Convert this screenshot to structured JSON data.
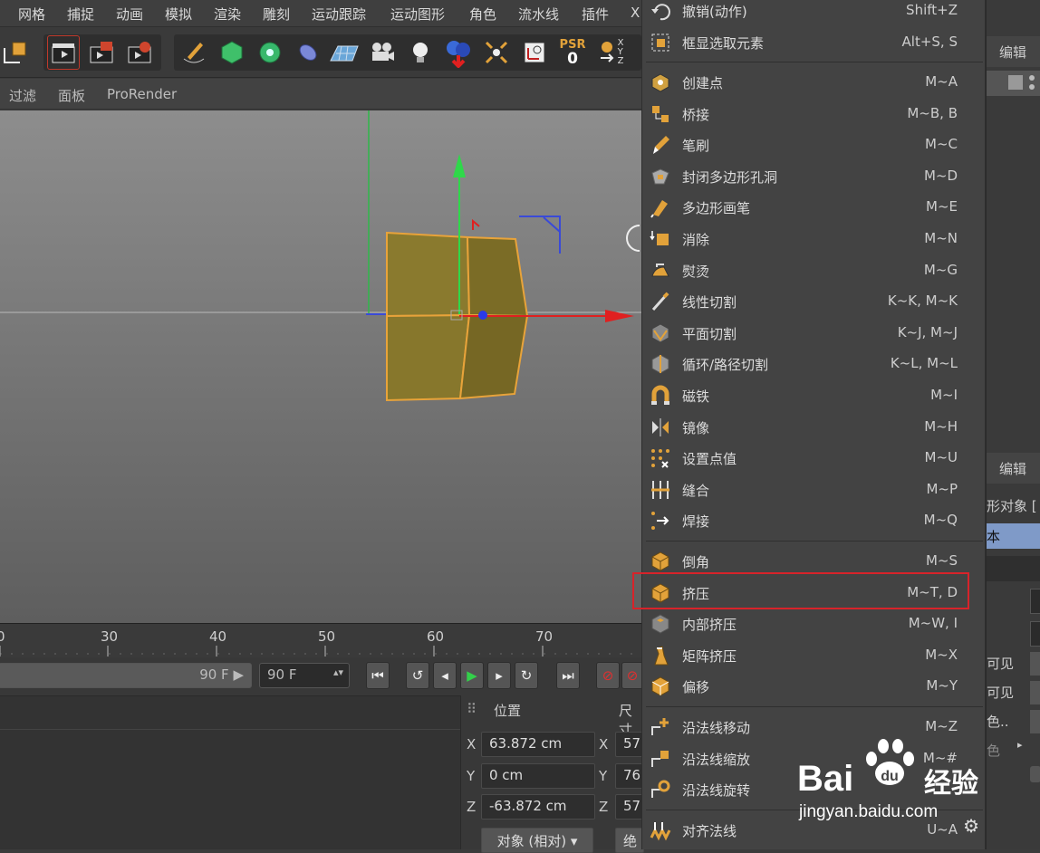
{
  "menubar": [
    "网格",
    "捕捉",
    "动画",
    "模拟",
    "渲染",
    "雕刻",
    "运动跟踪",
    "运动图形",
    "角色",
    "流水线",
    "插件",
    "X"
  ],
  "toolbar": {
    "psr_label": "PSR",
    "psr_value": "0",
    "xyz": [
      "X",
      "Y",
      "Z"
    ]
  },
  "viewport_menu": [
    "过滤",
    "面板",
    "ProRender"
  ],
  "timeline": {
    "ticks": [
      "0",
      "30",
      "40",
      "50",
      "60",
      "70"
    ]
  },
  "transport": {
    "end_frame_dim": "90 F",
    "end_frame": "90 F"
  },
  "coord_panel": {
    "title": "位置",
    "size_title": "尺寸",
    "rows": [
      {
        "axis": "X",
        "value": "63.872 cm",
        "size_axis": "X",
        "size": "57."
      },
      {
        "axis": "Y",
        "value": "0 cm",
        "size_axis": "Y",
        "size": "76."
      },
      {
        "axis": "Z",
        "value": "-63.872 cm",
        "size_axis": "Z",
        "size": "57."
      }
    ],
    "mode": "对象 (相对)",
    "mode2": "绝"
  },
  "right_panel": {
    "edit_top": "编辑",
    "edit_mid": "编辑",
    "obj_label": "形对象 [",
    "tab_label": "本",
    "props": [
      "可见",
      "可见",
      "色..",
      "色"
    ]
  },
  "context_menu": {
    "top_items": [
      {
        "label": "撤销(动作)",
        "shortcut": "Shift+Z",
        "icon": "undo-icon"
      },
      {
        "label": "框显选取元素",
        "shortcut": "Alt+S, S",
        "icon": "frame-selected-icon"
      }
    ],
    "groups": [
      [
        {
          "label": "创建点",
          "shortcut": "M~A",
          "icon": "create-point-icon"
        },
        {
          "label": "桥接",
          "shortcut": "M~B, B",
          "icon": "bridge-icon"
        },
        {
          "label": "笔刷",
          "shortcut": "M~C",
          "icon": "brush-icon"
        },
        {
          "label": "封闭多边形孔洞",
          "shortcut": "M~D",
          "icon": "close-polygon-hole-icon"
        },
        {
          "label": "多边形画笔",
          "shortcut": "M~E",
          "icon": "polygon-pen-icon"
        },
        {
          "label": "消除",
          "shortcut": "M~N",
          "icon": "dissolve-icon"
        },
        {
          "label": "熨烫",
          "shortcut": "M~G",
          "icon": "iron-icon"
        },
        {
          "label": "线性切割",
          "shortcut": "K~K, M~K",
          "icon": "line-cut-icon"
        },
        {
          "label": "平面切割",
          "shortcut": "K~J, M~J",
          "icon": "plane-cut-icon"
        },
        {
          "label": "循环/路径切割",
          "shortcut": "K~L, M~L",
          "icon": "loop-cut-icon"
        },
        {
          "label": "磁铁",
          "shortcut": "M~I",
          "icon": "magnet-icon"
        },
        {
          "label": "镜像",
          "shortcut": "M~H",
          "icon": "mirror-icon"
        },
        {
          "label": "设置点值",
          "shortcut": "M~U",
          "icon": "set-point-value-icon"
        },
        {
          "label": "缝合",
          "shortcut": "M~P",
          "icon": "stitch-icon"
        },
        {
          "label": "焊接",
          "shortcut": "M~Q",
          "icon": "weld-icon"
        }
      ],
      [
        {
          "label": "倒角",
          "shortcut": "M~S",
          "icon": "bevel-icon"
        },
        {
          "label": "挤压",
          "shortcut": "M~T, D",
          "icon": "extrude-icon",
          "highlighted": true
        },
        {
          "label": "内部挤压",
          "shortcut": "M~W, I",
          "icon": "extrude-inner-icon"
        },
        {
          "label": "矩阵挤压",
          "shortcut": "M~X",
          "icon": "matrix-extrude-icon"
        },
        {
          "label": "偏移",
          "shortcut": "M~Y",
          "icon": "offset-icon"
        }
      ],
      [
        {
          "label": "沿法线移动",
          "shortcut": "M~Z",
          "icon": "normal-move-icon"
        },
        {
          "label": "沿法线缩放",
          "shortcut": "M~#",
          "icon": "normal-scale-icon"
        },
        {
          "label": "沿法线旋转",
          "shortcut": "",
          "icon": "normal-rotate-icon"
        }
      ],
      [
        {
          "label": "对齐法线",
          "shortcut": "U~A",
          "icon": "align-normals-icon"
        }
      ]
    ]
  },
  "watermark": {
    "brand": "Bai",
    "brand2": "du",
    "cn": "经验",
    "url": "jingyan.baidu.com"
  },
  "colors": {
    "accent_red": "#d8232a",
    "menu_bg": "#434343",
    "object_fill": "#8a7a2e",
    "object_edge": "#e8a33a"
  }
}
